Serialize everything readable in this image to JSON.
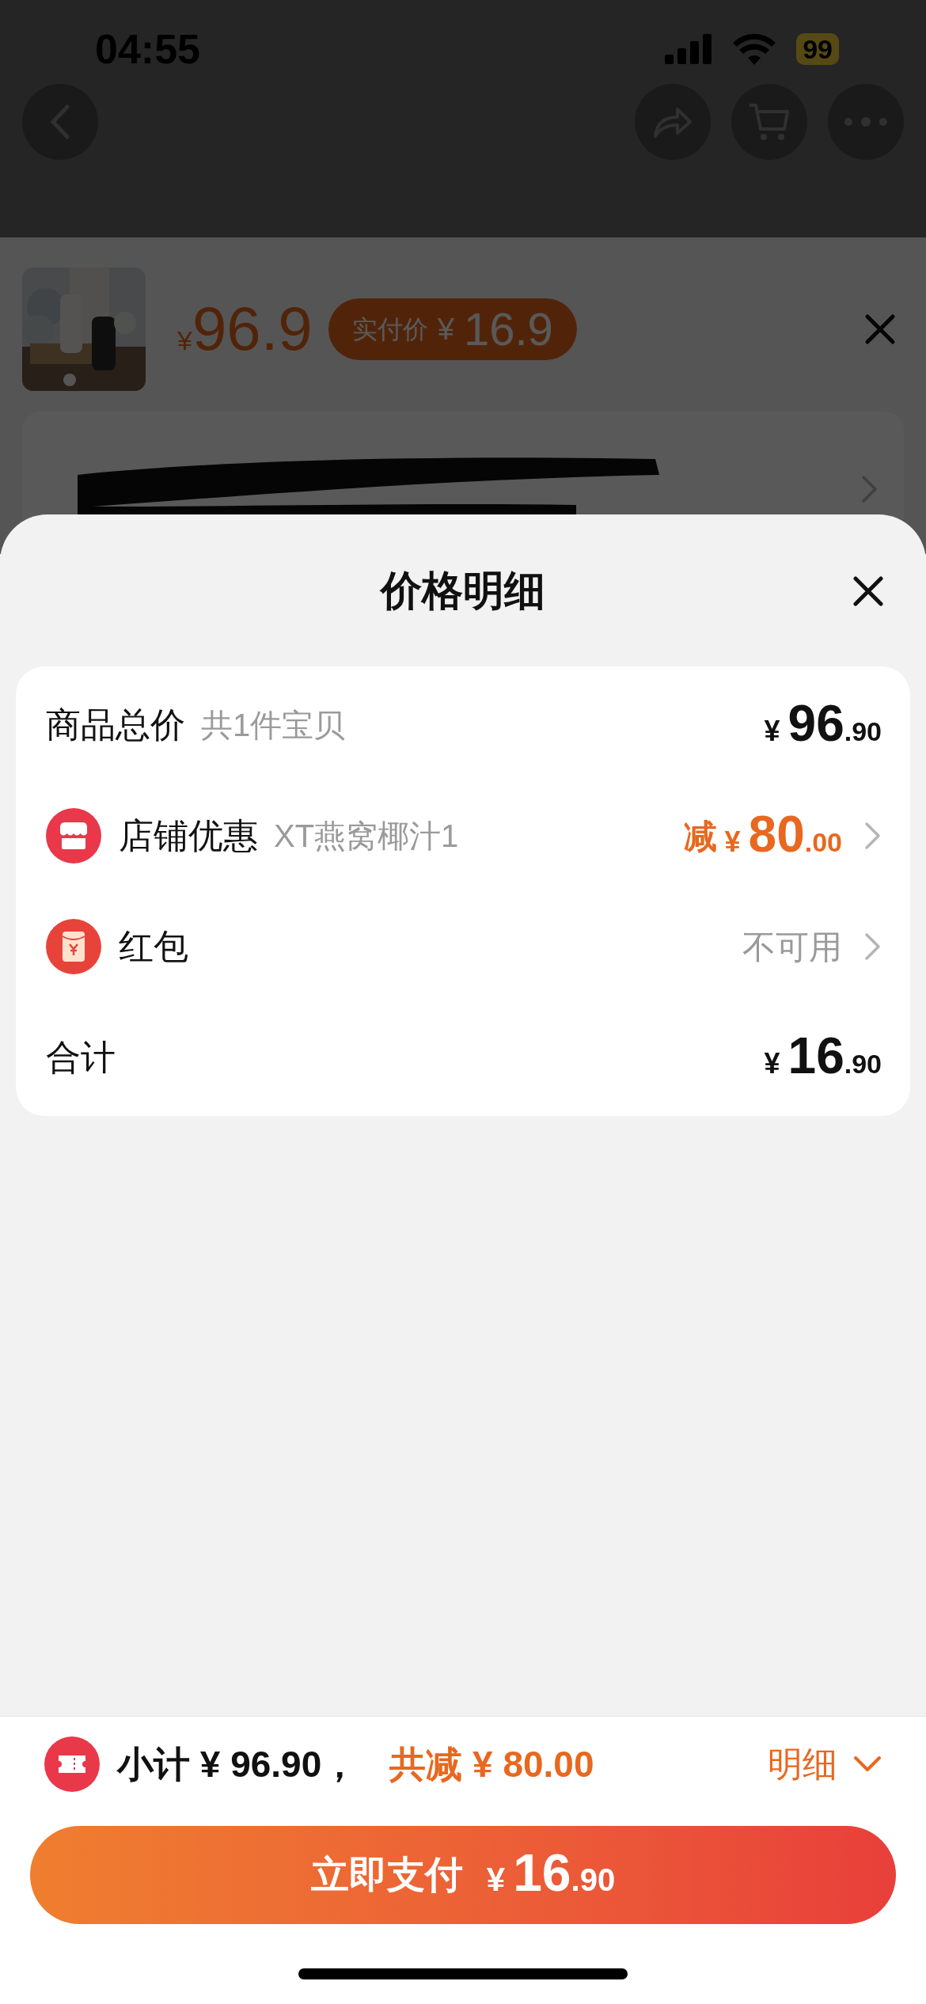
{
  "status_bar": {
    "time": "04:55",
    "battery": "99"
  },
  "product": {
    "price": {
      "currency": "¥",
      "amount": "96.9"
    },
    "paid_badge": {
      "label": "实付价",
      "currency": "¥",
      "amount": "16.9"
    }
  },
  "sheet": {
    "title": "价格明细",
    "rows": [
      {
        "kind": "plain",
        "label": "商品总价",
        "note": "共1件宝贝",
        "prefix": "",
        "price": {
          "currency": "¥",
          "integer": "96",
          "decimal": ".90"
        },
        "has_chevron": false
      },
      {
        "kind": "shop",
        "label": "店铺优惠",
        "note": "XT燕窝椰汁1",
        "prefix": "减",
        "price": {
          "currency": "¥",
          "integer": "80",
          "decimal": ".00"
        },
        "has_chevron": true
      },
      {
        "kind": "redpacket",
        "label": "红包",
        "status": "不可用",
        "has_chevron": true
      },
      {
        "kind": "plain",
        "label": "合计",
        "prefix": "",
        "price": {
          "currency": "¥",
          "integer": "16",
          "decimal": ".90"
        },
        "has_chevron": false
      }
    ]
  },
  "footer": {
    "subtotal": "小计 ¥ 96.90，",
    "discount": "共减 ¥ 80.00",
    "details_link": "明细",
    "pay_button": {
      "label": "立即支付",
      "currency": "¥",
      "integer": "16",
      "decimal": ".90"
    }
  }
}
